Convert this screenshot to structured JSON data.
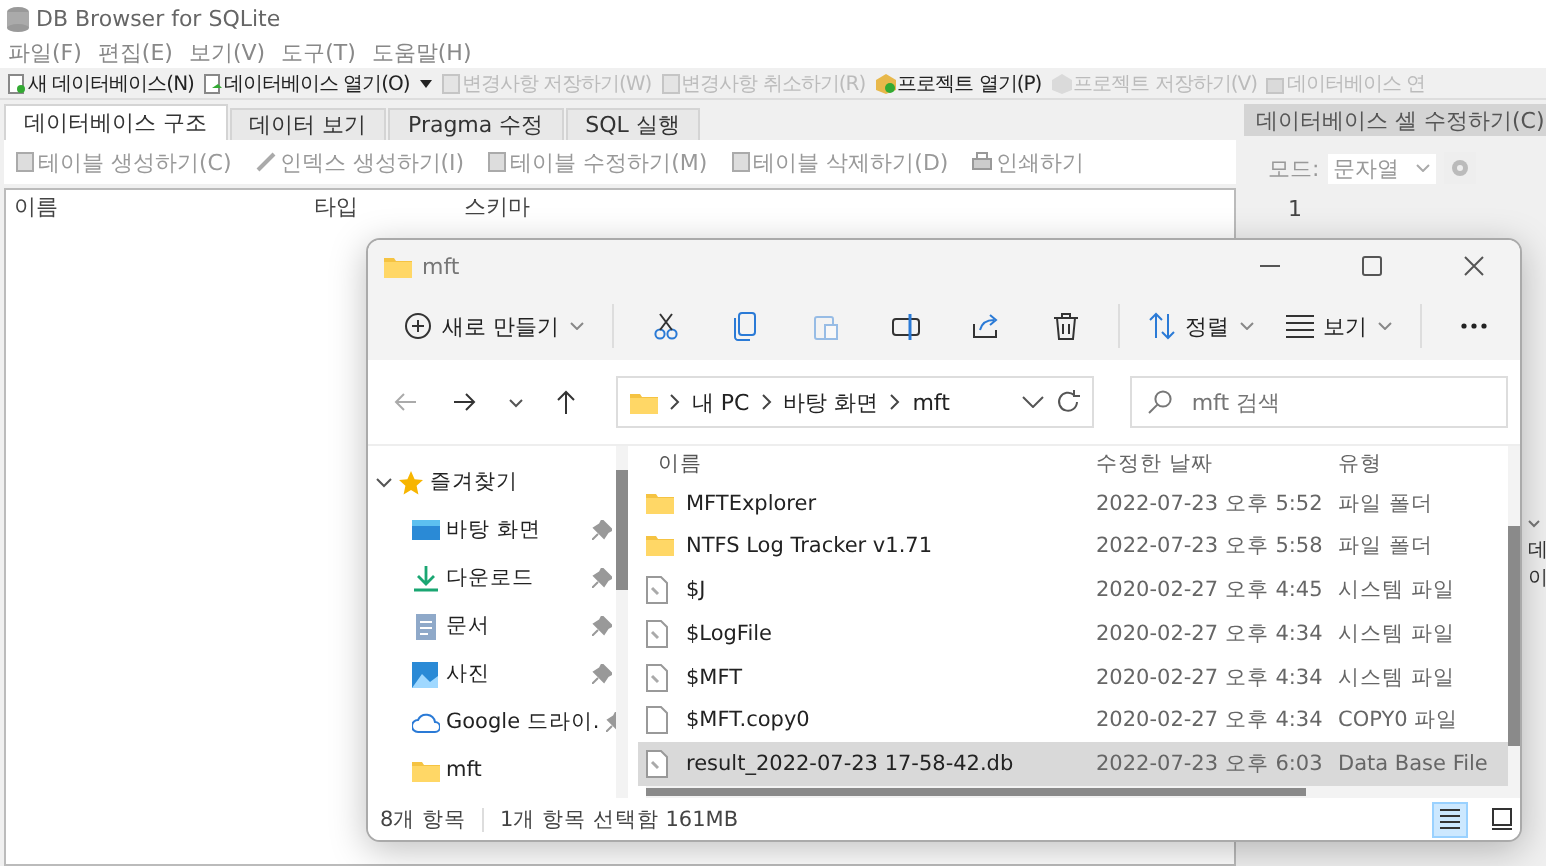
{
  "app": {
    "title": "DB Browser for SQLite",
    "menu": [
      "파일(F)",
      "편집(E)",
      "보기(V)",
      "도구(T)",
      "도움말(H)"
    ],
    "toolbar": [
      {
        "kind": "new",
        "label": "새 데이터베이스(N)",
        "disabled": false
      },
      {
        "kind": "open",
        "label": "데이터베이스 열기(O)",
        "disabled": false
      },
      {
        "kind": "dropdown"
      },
      {
        "kind": "save",
        "label": "변경사항 저장하기(W)",
        "disabled": true
      },
      {
        "kind": "undo",
        "label": "변경사항 취소하기(R)",
        "disabled": true
      },
      {
        "kind": "project-open",
        "label": "프로젝트 열기(P)",
        "disabled": false
      },
      {
        "kind": "project-save",
        "label": "프로젝트 저장하기(V)",
        "disabled": true
      },
      {
        "kind": "attach",
        "label": "데이터베이스 연",
        "disabled": true
      }
    ]
  },
  "tabs": [
    {
      "label": "데이터베이스 구조",
      "selected": true
    },
    {
      "label": "데이터 보기",
      "selected": false
    },
    {
      "label": "Pragma 수정",
      "selected": false
    },
    {
      "label": "SQL 실행",
      "selected": false
    }
  ],
  "structure_toolbar": [
    {
      "kind": "table",
      "label": "테이블 생성하기(C)",
      "disabled": true
    },
    {
      "kind": "index",
      "label": "인덱스 생성하기(I)",
      "disabled": true
    },
    {
      "kind": "table",
      "label": "테이블 수정하기(M)",
      "disabled": true
    },
    {
      "kind": "table",
      "label": "테이블 삭제하기(D)",
      "disabled": true
    },
    {
      "kind": "print",
      "label": "인쇄하기",
      "disabled": true
    }
  ],
  "table": {
    "columns": [
      "이름",
      "타입",
      "스키마"
    ]
  },
  "cell_editor": {
    "title": "데이터베이스 셀 수정하기(C)",
    "mode_label": "모드:",
    "mode_value": "문자열",
    "line_numbers": [
      "1"
    ]
  },
  "lower_dock": {
    "text": "데이"
  },
  "explorer": {
    "title": "mft",
    "commands": [
      {
        "kind": "new",
        "label": "새로 만들기",
        "disabled": false
      },
      {
        "kind": "cut",
        "disabled": false
      },
      {
        "kind": "copy",
        "disabled": false
      },
      {
        "kind": "paste",
        "disabled": true
      },
      {
        "kind": "rename",
        "disabled": false
      },
      {
        "kind": "share",
        "disabled": false
      },
      {
        "kind": "delete",
        "disabled": false
      },
      {
        "kind": "sort",
        "label": "정렬",
        "disabled": false
      },
      {
        "kind": "view",
        "label": "보기",
        "disabled": false
      },
      {
        "kind": "more",
        "disabled": false
      }
    ],
    "path": [
      "내 PC",
      "바탕 화면",
      "mft"
    ],
    "search": {
      "placeholder": "mft 검색"
    },
    "nav": {
      "label": "즐겨찾기",
      "expanded": true,
      "children": [
        {
          "kind": "desktop",
          "label": "바탕 화면",
          "pinned": true
        },
        {
          "kind": "download",
          "label": "다운로드",
          "pinned": true
        },
        {
          "kind": "document",
          "label": "문서",
          "pinned": true
        },
        {
          "kind": "picture",
          "label": "사진",
          "pinned": true
        },
        {
          "kind": "cloud",
          "label": "Google 드라이.",
          "pinned": true
        },
        {
          "kind": "folder",
          "label": "mft",
          "pinned": false
        }
      ]
    },
    "columns": [
      "이름",
      "수정한 날짜",
      "유형"
    ],
    "files": [
      {
        "kind": "folder",
        "name": "MFTExplorer",
        "date": "2022-07-23 오후 5:52",
        "type": "파일 폴더",
        "selected": false
      },
      {
        "kind": "folder",
        "name": "NTFS Log Tracker v1.71",
        "date": "2022-07-23 오후 5:58",
        "type": "파일 폴더",
        "selected": false
      },
      {
        "kind": "system",
        "name": "$J",
        "date": "2020-02-27 오후 4:45",
        "type": "시스템 파일",
        "selected": false
      },
      {
        "kind": "system",
        "name": "$LogFile",
        "date": "2020-02-27 오후 4:34",
        "type": "시스템 파일",
        "selected": false
      },
      {
        "kind": "system",
        "name": "$MFT",
        "date": "2020-02-27 오후 4:34",
        "type": "시스템 파일",
        "selected": false
      },
      {
        "kind": "blank",
        "name": "$MFT.copy0",
        "date": "2020-02-27 오후 4:34",
        "type": "COPY0 파일",
        "selected": false
      },
      {
        "kind": "system",
        "name": "result_2022-07-23 17-58-42.db",
        "date": "2022-07-23 오후 6:03",
        "type": "Data Base File",
        "selected": true
      }
    ],
    "status": [
      "8개 항목",
      "1개 항목 선택함 161MB"
    ],
    "view_modes": [
      {
        "kind": "details",
        "selected": true
      },
      {
        "kind": "tiles",
        "selected": false
      }
    ]
  }
}
